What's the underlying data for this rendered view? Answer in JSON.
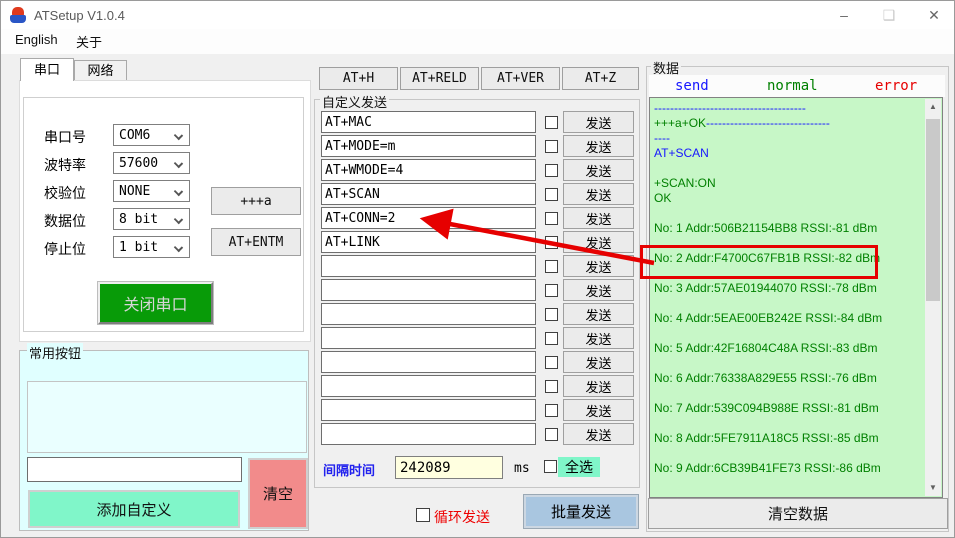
{
  "window": {
    "title": "ATSetup V1.0.4",
    "controls": {
      "minimize": "–",
      "maximize": "❑",
      "close": "✕"
    }
  },
  "menu": {
    "items": [
      "English",
      "关于"
    ]
  },
  "serial_panel": {
    "tabs": [
      {
        "label": "串口"
      },
      {
        "label": "网络"
      }
    ],
    "fields": [
      {
        "label": "串口号",
        "value": "COM6"
      },
      {
        "label": "波特率",
        "value": "57600"
      },
      {
        "label": "校验位",
        "value": "NONE"
      },
      {
        "label": "数据位",
        "value": "8 bit"
      },
      {
        "label": "停止位",
        "value": "1 bit"
      }
    ],
    "plus_a_button": "+++a",
    "entm_button": "AT+ENTM",
    "close_port_button": "关闭串口"
  },
  "common_buttons": {
    "group_label": "常用按钮",
    "input_value": "",
    "add_custom_button": "添加自定义",
    "clear_button": "清空"
  },
  "quick_commands": [
    "AT+H",
    "AT+RELD",
    "AT+VER",
    "AT+Z"
  ],
  "custom_send": {
    "group_label": "自定义发送",
    "send_label": "发送",
    "rows": [
      "AT+MAC",
      "AT+MODE=m",
      "AT+WMODE=4",
      "AT+SCAN",
      "AT+CONN=2",
      "AT+LINK",
      "",
      "",
      "",
      "",
      "",
      "",
      "",
      ""
    ],
    "interval_label": "间隔时间",
    "interval_value": "242089",
    "interval_unit": "ms",
    "select_all_label": "全选",
    "loop_send_label": "循环发送",
    "batch_send_button": "批量发送"
  },
  "data_panel": {
    "group_label": "数据",
    "legend": [
      {
        "label": "send",
        "color": "#1616ff"
      },
      {
        "label": "normal",
        "color": "#008000"
      },
      {
        "label": "error",
        "color": "#e60000"
      }
    ],
    "log_lines": [
      [
        {
          "t": "--------------------------------------",
          "c": "#1616ff"
        }
      ],
      [
        {
          "t": "+++a+OK",
          "c": "#008000"
        },
        {
          "t": "-------------------------------",
          "c": "#1616ff"
        }
      ],
      [
        {
          "t": "----",
          "c": "#1616ff"
        }
      ],
      [
        {
          "t": "AT+SCAN",
          "c": "#1616ff"
        }
      ],
      [],
      [
        {
          "t": "+SCAN:ON",
          "c": "#008000"
        }
      ],
      [
        {
          "t": "OK",
          "c": "#008000"
        }
      ],
      [],
      [
        {
          "t": "No: 1 Addr:506B21154BB8 RSSI:-81 dBm",
          "c": "#008000"
        }
      ],
      [],
      [
        {
          "t": "No: 2 Addr:F4700C67FB1B RSSI:-82 dBm",
          "c": "#008000"
        }
      ],
      [],
      [
        {
          "t": "No: 3 Addr:57AE01944070 RSSI:-78 dBm",
          "c": "#008000"
        }
      ],
      [],
      [
        {
          "t": "No: 4 Addr:5EAE00EB242E RSSI:-84 dBm",
          "c": "#008000"
        }
      ],
      [],
      [
        {
          "t": "No: 5 Addr:42F16804C48A RSSI:-83 dBm",
          "c": "#008000"
        }
      ],
      [],
      [
        {
          "t": "No: 6 Addr:76338A829E55 RSSI:-76 dBm",
          "c": "#008000"
        }
      ],
      [],
      [
        {
          "t": "No: 7 Addr:539C094B988E RSSI:-81 dBm",
          "c": "#008000"
        }
      ],
      [],
      [
        {
          "t": "No: 8 Addr:5FE7911A18C5 RSSI:-85 dBm",
          "c": "#008000"
        }
      ],
      [],
      [
        {
          "t": "No: 9 Addr:6CB39B41FE73 RSSI:-86 dBm",
          "c": "#008000"
        }
      ]
    ],
    "clear_data_button": "清空数据"
  },
  "annotation": {
    "highlighted_entry": "No: 2 Addr:F4700C67FB1B RSSI:-82 dBm",
    "arrow_target_command": "AT+CONN=2",
    "color": "#e60000"
  },
  "colors": {
    "send_blue": "#1616ff",
    "normal_green": "#008000",
    "error_red": "#e60000",
    "log_background": "#c7f7c7",
    "panel_cyan": "#e0ffff",
    "mint_green": "#80f6c9",
    "coral": "#f28b8b",
    "port_open_green": "#089b08",
    "batch_blue": "#a9c6e0",
    "interval_yellow": "#ffffe0"
  }
}
